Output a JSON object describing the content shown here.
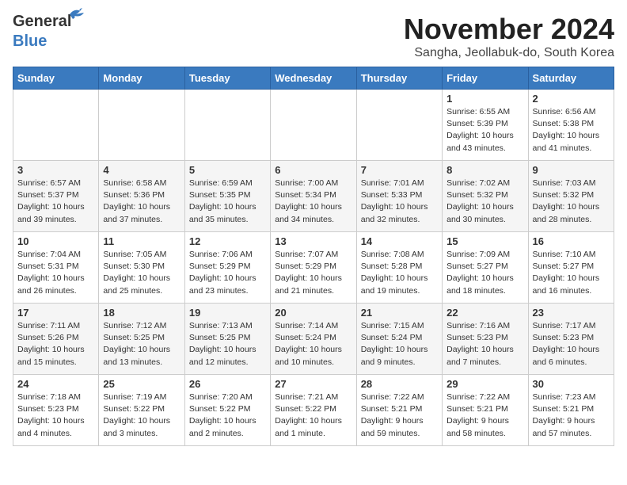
{
  "logo": {
    "general": "General",
    "blue": "Blue"
  },
  "title": "November 2024",
  "subtitle": "Sangha, Jeollabuk-do, South Korea",
  "days_of_week": [
    "Sunday",
    "Monday",
    "Tuesday",
    "Wednesday",
    "Thursday",
    "Friday",
    "Saturday"
  ],
  "weeks": [
    [
      null,
      null,
      null,
      null,
      null,
      {
        "day": "1",
        "sunrise": "Sunrise: 6:55 AM",
        "sunset": "Sunset: 5:39 PM",
        "daylight": "Daylight: 10 hours and 43 minutes."
      },
      {
        "day": "2",
        "sunrise": "Sunrise: 6:56 AM",
        "sunset": "Sunset: 5:38 PM",
        "daylight": "Daylight: 10 hours and 41 minutes."
      }
    ],
    [
      {
        "day": "3",
        "sunrise": "Sunrise: 6:57 AM",
        "sunset": "Sunset: 5:37 PM",
        "daylight": "Daylight: 10 hours and 39 minutes."
      },
      {
        "day": "4",
        "sunrise": "Sunrise: 6:58 AM",
        "sunset": "Sunset: 5:36 PM",
        "daylight": "Daylight: 10 hours and 37 minutes."
      },
      {
        "day": "5",
        "sunrise": "Sunrise: 6:59 AM",
        "sunset": "Sunset: 5:35 PM",
        "daylight": "Daylight: 10 hours and 35 minutes."
      },
      {
        "day": "6",
        "sunrise": "Sunrise: 7:00 AM",
        "sunset": "Sunset: 5:34 PM",
        "daylight": "Daylight: 10 hours and 34 minutes."
      },
      {
        "day": "7",
        "sunrise": "Sunrise: 7:01 AM",
        "sunset": "Sunset: 5:33 PM",
        "daylight": "Daylight: 10 hours and 32 minutes."
      },
      {
        "day": "8",
        "sunrise": "Sunrise: 7:02 AM",
        "sunset": "Sunset: 5:32 PM",
        "daylight": "Daylight: 10 hours and 30 minutes."
      },
      {
        "day": "9",
        "sunrise": "Sunrise: 7:03 AM",
        "sunset": "Sunset: 5:32 PM",
        "daylight": "Daylight: 10 hours and 28 minutes."
      }
    ],
    [
      {
        "day": "10",
        "sunrise": "Sunrise: 7:04 AM",
        "sunset": "Sunset: 5:31 PM",
        "daylight": "Daylight: 10 hours and 26 minutes."
      },
      {
        "day": "11",
        "sunrise": "Sunrise: 7:05 AM",
        "sunset": "Sunset: 5:30 PM",
        "daylight": "Daylight: 10 hours and 25 minutes."
      },
      {
        "day": "12",
        "sunrise": "Sunrise: 7:06 AM",
        "sunset": "Sunset: 5:29 PM",
        "daylight": "Daylight: 10 hours and 23 minutes."
      },
      {
        "day": "13",
        "sunrise": "Sunrise: 7:07 AM",
        "sunset": "Sunset: 5:29 PM",
        "daylight": "Daylight: 10 hours and 21 minutes."
      },
      {
        "day": "14",
        "sunrise": "Sunrise: 7:08 AM",
        "sunset": "Sunset: 5:28 PM",
        "daylight": "Daylight: 10 hours and 19 minutes."
      },
      {
        "day": "15",
        "sunrise": "Sunrise: 7:09 AM",
        "sunset": "Sunset: 5:27 PM",
        "daylight": "Daylight: 10 hours and 18 minutes."
      },
      {
        "day": "16",
        "sunrise": "Sunrise: 7:10 AM",
        "sunset": "Sunset: 5:27 PM",
        "daylight": "Daylight: 10 hours and 16 minutes."
      }
    ],
    [
      {
        "day": "17",
        "sunrise": "Sunrise: 7:11 AM",
        "sunset": "Sunset: 5:26 PM",
        "daylight": "Daylight: 10 hours and 15 minutes."
      },
      {
        "day": "18",
        "sunrise": "Sunrise: 7:12 AM",
        "sunset": "Sunset: 5:25 PM",
        "daylight": "Daylight: 10 hours and 13 minutes."
      },
      {
        "day": "19",
        "sunrise": "Sunrise: 7:13 AM",
        "sunset": "Sunset: 5:25 PM",
        "daylight": "Daylight: 10 hours and 12 minutes."
      },
      {
        "day": "20",
        "sunrise": "Sunrise: 7:14 AM",
        "sunset": "Sunset: 5:24 PM",
        "daylight": "Daylight: 10 hours and 10 minutes."
      },
      {
        "day": "21",
        "sunrise": "Sunrise: 7:15 AM",
        "sunset": "Sunset: 5:24 PM",
        "daylight": "Daylight: 10 hours and 9 minutes."
      },
      {
        "day": "22",
        "sunrise": "Sunrise: 7:16 AM",
        "sunset": "Sunset: 5:23 PM",
        "daylight": "Daylight: 10 hours and 7 minutes."
      },
      {
        "day": "23",
        "sunrise": "Sunrise: 7:17 AM",
        "sunset": "Sunset: 5:23 PM",
        "daylight": "Daylight: 10 hours and 6 minutes."
      }
    ],
    [
      {
        "day": "24",
        "sunrise": "Sunrise: 7:18 AM",
        "sunset": "Sunset: 5:23 PM",
        "daylight": "Daylight: 10 hours and 4 minutes."
      },
      {
        "day": "25",
        "sunrise": "Sunrise: 7:19 AM",
        "sunset": "Sunset: 5:22 PM",
        "daylight": "Daylight: 10 hours and 3 minutes."
      },
      {
        "day": "26",
        "sunrise": "Sunrise: 7:20 AM",
        "sunset": "Sunset: 5:22 PM",
        "daylight": "Daylight: 10 hours and 2 minutes."
      },
      {
        "day": "27",
        "sunrise": "Sunrise: 7:21 AM",
        "sunset": "Sunset: 5:22 PM",
        "daylight": "Daylight: 10 hours and 1 minute."
      },
      {
        "day": "28",
        "sunrise": "Sunrise: 7:22 AM",
        "sunset": "Sunset: 5:21 PM",
        "daylight": "Daylight: 9 hours and 59 minutes."
      },
      {
        "day": "29",
        "sunrise": "Sunrise: 7:22 AM",
        "sunset": "Sunset: 5:21 PM",
        "daylight": "Daylight: 9 hours and 58 minutes."
      },
      {
        "day": "30",
        "sunrise": "Sunrise: 7:23 AM",
        "sunset": "Sunset: 5:21 PM",
        "daylight": "Daylight: 9 hours and 57 minutes."
      }
    ]
  ]
}
